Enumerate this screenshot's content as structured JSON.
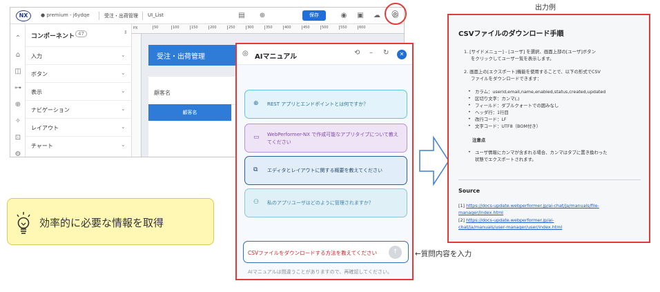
{
  "editor": {
    "logo": "NX",
    "project": "● premium - j6ydqe",
    "tab1": "受注・出荷管理",
    "tab2": "UI_List",
    "save_label": "保存",
    "ruler_unit": "PX",
    "ruler_ticks": [
      "50",
      "100",
      "150",
      "200",
      "250",
      "300",
      "350",
      "400",
      "450",
      "500",
      "550",
      "600"
    ],
    "components": {
      "title": "コンポーネント",
      "count": "47",
      "items": [
        "入力",
        "ボタン",
        "表示",
        "ナビゲーション",
        "レイアウト",
        "チャート"
      ]
    },
    "canvas": {
      "header": "受注・出荷管理",
      "field_label": "顧客名",
      "column": "顧客名"
    }
  },
  "tip": {
    "text": "効率的に必要な情報を取得"
  },
  "ai_panel": {
    "title": "AIマニュアル",
    "suggestions": [
      "REST アプリとエンドポイントとは何ですか？",
      "WebPerformer-NX で作成可能なアプリタイプについて教えてください",
      "エディタとレイアウトに関する概要を教えてください",
      "私のアプリユーザはどのように管理されますか？"
    ],
    "input_value": "CSVファイルをダウンロードする方法を教えてください",
    "disclaimer": "AIマニュアルは間違うことがありますので、再確認してください。"
  },
  "annotations": {
    "input_note": "←質問内容を入力",
    "example_label": "出力例"
  },
  "output_example": {
    "title": "CSVファイルのダウンロード手順",
    "step1_l1": "1. [サイドメニュー] - [ユーザ] を選択、画面上部の[ユーザ]ボタン",
    "step1_l2": "をクリックしてユーザー覧を表示します。",
    "step2_l1": "2. 画面上の[エクスポート]機能を使用することで、以下の形式でCSV",
    "step2_l2": "ファイルをダウンロードできます：",
    "bullets": [
      "カラム：userid,email,name,enabled,status,created,updated",
      "区切り文字：カンマ(,)",
      "フィールド：ダブルクォートでの囲みなし",
      "ヘッダ行：1行目",
      "改行コード：LF",
      "文字コード：UTF8（BOM付き）"
    ],
    "note_title": "注意点",
    "note_l1": "ユーザ情報にカンマが含まれる場合、カンマはタブに置き換わった",
    "note_l2": "状態でエクスポートされます。",
    "source_title": "Source",
    "source1_prefix": "[1] ",
    "source1_l1": "https://docs-update.webperformer.jp/ai-chat/ja/manuals/file-",
    "source1_l2": "manager/index.html",
    "source2_prefix": "[2] ",
    "source2_l1": "https://docs-update.webperformer.jp/ai-",
    "source2_l2": "chat/ja/manuals/user-manager/user/index.html"
  }
}
